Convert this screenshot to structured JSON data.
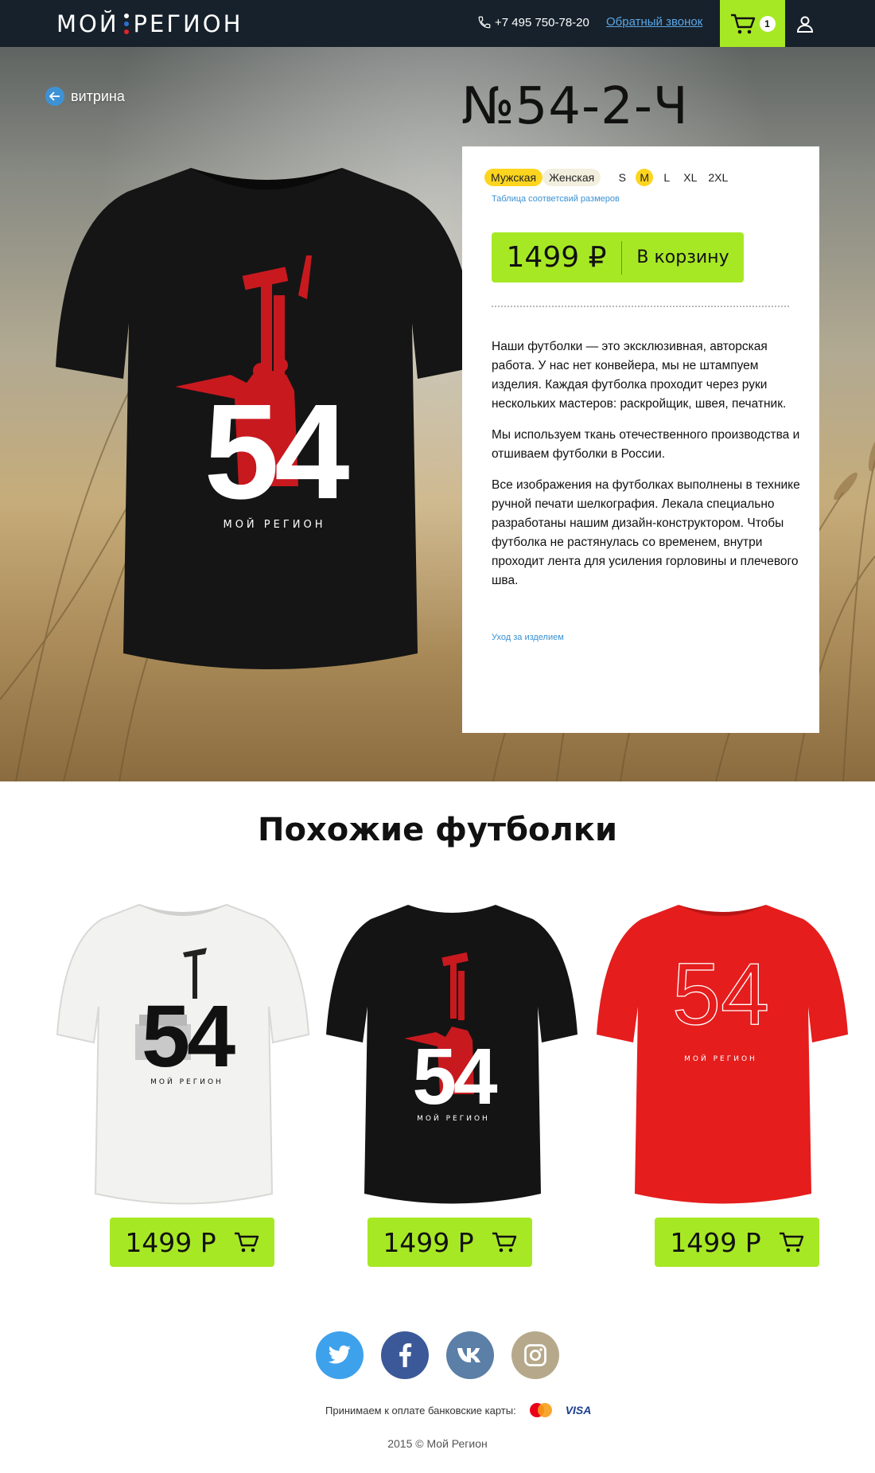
{
  "header": {
    "logo_left": "МОЙ",
    "logo_right": "РЕГИОН",
    "phone": "+7 495 750-78-20",
    "callback_label": "Обратный звонок",
    "cart_count": "1",
    "icons": {
      "phone": "phone-icon",
      "cart": "cart-icon",
      "user": "user-icon"
    },
    "colors": {
      "background": "#17212b",
      "cart_bg": "#a7e825",
      "link": "#5aa7e6"
    }
  },
  "hero": {
    "back_label": "витрина",
    "title": "№54-2-Ч",
    "shirt_print_number": "54",
    "shirt_print_caption": "МОЙ РЕГИОН"
  },
  "card": {
    "genders": [
      {
        "label": "Мужская",
        "selected": true
      },
      {
        "label": "Женская",
        "selected": false
      }
    ],
    "sizes": [
      {
        "label": "S",
        "selected": false
      },
      {
        "label": "M",
        "selected": true
      },
      {
        "label": "L",
        "selected": false
      },
      {
        "label": "XL",
        "selected": false
      },
      {
        "label": "2XL",
        "selected": false
      }
    ],
    "size_table_link": "Таблица соответсвий размеров",
    "price": "1499 ₽",
    "add_to_cart": "В корзину",
    "description": [
      "Наши футболки — это эксклюзивная, авторская работа. У нас нет конвейера, мы не штампуем изделия. Каждая футболка проходит через руки нескольких мастеров: раскройщик, швея, печатник.",
      "Мы используем ткань отечественного производства и отшиваем футболки в России.",
      "Все изображения на футболках выполнены в технике ручной печати шелкография. Лекала специально разработаны нашим дизайн-конструктором. Чтобы футболка не растянулась со временем, внутри проходит лента для усиления горловины и плечевого шва."
    ],
    "care_link": "Уход за изделием",
    "colors": {
      "accent": "#a7e825",
      "selected": "#fdd51f",
      "link": "#3a91d2"
    }
  },
  "similar": {
    "title": "Похожие футболки",
    "items": [
      {
        "shirt_color": "white",
        "print_number": "54",
        "print_caption": "МОЙ РЕГИОН",
        "price": "1499 Р"
      },
      {
        "shirt_color": "black",
        "print_number": "54",
        "print_caption": "МОЙ РЕГИОН",
        "price": "1499 Р"
      },
      {
        "shirt_color": "red",
        "print_number": "54",
        "print_caption": "МОЙ РЕГИОН",
        "price": "1499 Р"
      }
    ]
  },
  "footer": {
    "socials": [
      {
        "icon": "twitter-icon",
        "color": "#3ea1ec"
      },
      {
        "icon": "facebook-icon",
        "color": "#3b5998"
      },
      {
        "icon": "vk-icon",
        "color": "#5b7fa6"
      },
      {
        "icon": "instagram-icon",
        "color": "#b6a98b"
      }
    ],
    "payment_text": "Принимаем к оплате банковские карты:",
    "visa_label": "VISA",
    "copyright": "2015 © Мой Регион"
  }
}
